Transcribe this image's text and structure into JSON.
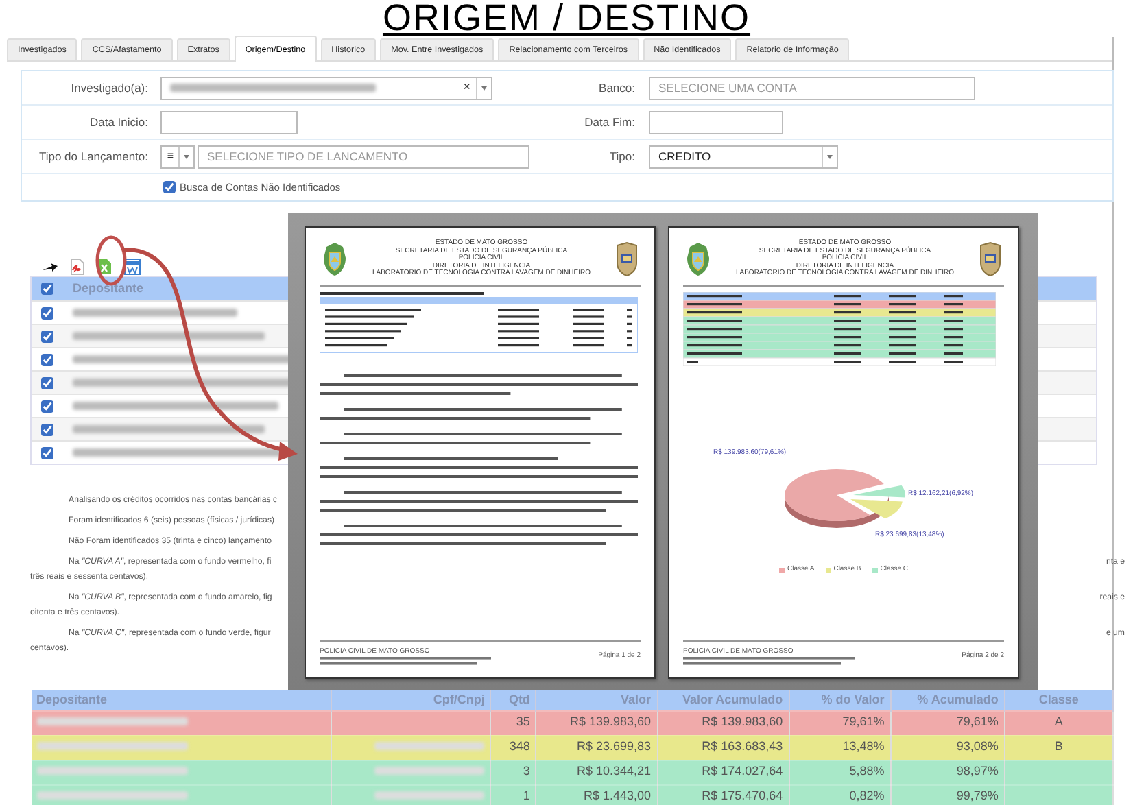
{
  "title": "ORIGEM / DESTINO",
  "tabs": [
    {
      "label": "Investigados",
      "selected": false
    },
    {
      "label": "CCS/Afastamento",
      "selected": false
    },
    {
      "label": "Extratos",
      "selected": false
    },
    {
      "label": "Origem/Destino",
      "selected": true
    },
    {
      "label": "Historico",
      "selected": false
    },
    {
      "label": "Mov. Entre Investigados",
      "selected": false
    },
    {
      "label": "Relacionamento com Terceiros",
      "selected": false
    },
    {
      "label": "Não Identificados",
      "selected": false
    },
    {
      "label": "Relatorio de Informação",
      "selected": false
    }
  ],
  "form": {
    "investigado_label": "Investigado(a):",
    "investigado_redacted": true,
    "clear": "×",
    "banco_label": "Banco:",
    "banco_placeholder": "SELECIONE UMA CONTA",
    "data_inicio_label": "Data Inicio:",
    "data_fim_label": "Data Fim:",
    "tipo_lancamento_label": "Tipo do Lançamento:",
    "tipo_lancamento_button": "≡",
    "tipo_lancamento_placeholder": "SELECIONE TIPO DE LANCAMENTO",
    "tipo_label": "Tipo:",
    "tipo_value": "CREDITO",
    "checkbox_label": "Busca de Contas Não Identificados",
    "checkbox_checked": true
  },
  "toolbar": [
    {
      "kind": "arrow"
    },
    {
      "kind": "pdf"
    },
    {
      "kind": "excel"
    },
    {
      "kind": "word"
    }
  ],
  "depositors": {
    "header": "Depositante",
    "header_checked": true,
    "rows": [
      {
        "checked": true,
        "redacted": true
      },
      {
        "checked": true,
        "redacted": true
      },
      {
        "checked": true,
        "redacted": true
      },
      {
        "checked": true,
        "redacted": true
      },
      {
        "checked": true,
        "redacted": true
      },
      {
        "checked": true,
        "redacted": true
      },
      {
        "checked": true,
        "redacted": true
      }
    ]
  },
  "paragraphs": [
    {
      "lines": [
        {
          "left": "Analisando os créditos ocorridos nas contas bancárias c"
        }
      ]
    },
    {
      "lines": [
        {
          "left": "Foram identificados 6 (seis) pessoas (físicas / jurídicas)"
        }
      ]
    },
    {
      "lines": [
        {
          "left": "Não Foram identificados 35 (trinta e cinco) lançamento"
        }
      ]
    },
    {
      "lines": [
        {
          "left": "Na *\"CURVA A\"*, representada com o fundo vermelho, fi",
          "right": "nta e"
        },
        {
          "left": "três reais e sessenta centavos)."
        }
      ]
    },
    {
      "lines": [
        {
          "left": "Na *\"CURVA B\"*, representada com o fundo amarelo, fig",
          "right": "reais e"
        },
        {
          "left": "oitenta e três centavos)."
        }
      ]
    },
    {
      "lines": [
        {
          "left": "Na *\"CURVA C\"*, representada com o fundo verde, figur",
          "right": "e um"
        },
        {
          "left": "centavos)."
        }
      ]
    }
  ],
  "summary": {
    "columns": [
      "Depositante",
      "Cpf/Cnpj",
      "Qtd",
      "Valor",
      "Valor Acumulado",
      "% do Valor",
      "% Acumulado",
      "Classe"
    ],
    "rows": [
      {
        "color": "#f0aaaa",
        "depositante_redacted": true,
        "cpf_redacted": false,
        "qtd": "35",
        "valor": "R$ 139.983,60",
        "acumulado": "R$ 139.983,60",
        "pct": "79,61%",
        "pct_acumulado": "79,61%",
        "classe": "A"
      },
      {
        "color": "#e8e88c",
        "depositante_redacted": true,
        "cpf_redacted": true,
        "qtd": "348",
        "valor": "R$ 23.699,83",
        "acumulado": "R$ 163.683,43",
        "pct": "13,48%",
        "pct_acumulado": "93,08%",
        "classe": "B"
      },
      {
        "color": "#a8e8c8",
        "depositante_redacted": true,
        "cpf_redacted": true,
        "qtd": "3",
        "valor": "R$ 10.344,21",
        "acumulado": "R$ 174.027,64",
        "pct": "5,88%",
        "pct_acumulado": "98,97%"
      },
      {
        "color": "#a8e8c8",
        "depositante_redacted": true,
        "cpf_redacted": true,
        "qtd": "1",
        "valor": "R$ 1.443,00",
        "acumulado": "R$ 175.470,64",
        "pct": "0,82%",
        "pct_acumulado": "99,79%"
      }
    ]
  },
  "document_preview": {
    "pages": [
      {
        "kind": "text",
        "header_lines": [
          "ESTADO DE MATO GROSSO",
          "SECRETARIA DE ESTADO DE SEGURANÇA PÚBLICA",
          "POLICIA CIVIL",
          "DIRETORIA DE INTELIGENCIA",
          "LABORATORIO DE TECNOLOGIA CONTRA LAVAGEM DE DINHEIRO"
        ],
        "footer_title": "POLICIA CIVIL DE MATO GROSSO",
        "page_number": "Página 1 de 2"
      },
      {
        "kind": "chart",
        "header_lines": [
          "ESTADO DE MATO GROSSO",
          "SECRETARIA DE ESTADO DE SEGURANÇA PÚBLICA",
          "POLICIA CIVIL",
          "DIRETORIA DE INTELIGENCIA",
          "LABORATORIO DE TECNOLOGIA CONTRA LAVAGEM DE DINHEIRO"
        ],
        "pie_labels": [
          "R$ 139.983,60(79,61%)",
          "R$ 12.162,21(6,92%)",
          "R$ 23.699,83(13,48%)"
        ],
        "legend": [
          {
            "label": "Classe A",
            "color": "#f0a8a8"
          },
          {
            "label": "Classe B",
            "color": "#e8e890"
          },
          {
            "label": "Classe C",
            "color": "#a8e8c8"
          }
        ],
        "footer_title": "POLICIA CIVIL DE MATO GROSSO",
        "page_number": "Página 2 de 2"
      }
    ]
  }
}
